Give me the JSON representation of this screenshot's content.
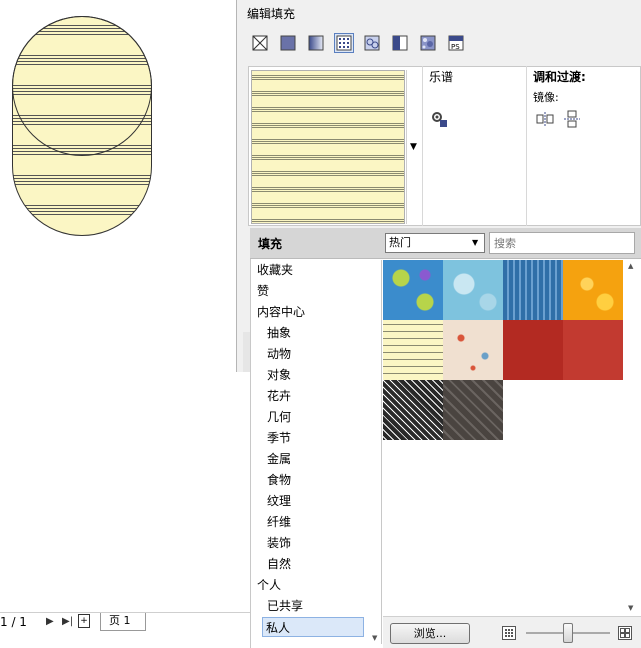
{
  "dialog": {
    "title": "编辑填充"
  },
  "fill_types": [
    {
      "name": "no-fill",
      "selected": false
    },
    {
      "name": "uniform-fill",
      "selected": false
    },
    {
      "name": "fountain-fill",
      "selected": false
    },
    {
      "name": "vector-pattern-fill",
      "selected": true
    },
    {
      "name": "bitmap-pattern-fill",
      "selected": false
    },
    {
      "name": "two-color-pattern-fill",
      "selected": false
    },
    {
      "name": "texture-fill",
      "selected": false
    },
    {
      "name": "postscript-fill",
      "selected": false
    }
  ],
  "preview": {
    "fill_name": "乐谱",
    "blend_title": "调和过渡:",
    "mirror_label": "镜像:"
  },
  "picker": {
    "label": "填充",
    "filter_value": "热门",
    "search_placeholder": "搜索",
    "browse_label": "浏览...",
    "categories": [
      {
        "label": "收藏夹",
        "level": 0
      },
      {
        "label": "赞",
        "level": 0
      },
      {
        "label": "内容中心",
        "level": 0
      },
      {
        "label": "抽象",
        "level": 1
      },
      {
        "label": "动物",
        "level": 1
      },
      {
        "label": "对象",
        "level": 1
      },
      {
        "label": "花卉",
        "level": 1
      },
      {
        "label": "几何",
        "level": 1
      },
      {
        "label": "季节",
        "level": 1
      },
      {
        "label": "金属",
        "level": 1
      },
      {
        "label": "食物",
        "level": 1
      },
      {
        "label": "纹理",
        "level": 1
      },
      {
        "label": "纤维",
        "level": 1
      },
      {
        "label": "装饰",
        "level": 1
      },
      {
        "label": "自然",
        "level": 1
      },
      {
        "label": "个人",
        "level": 0
      },
      {
        "label": "已共享",
        "level": 1
      },
      {
        "label": "私人",
        "level": 1,
        "selected": true
      }
    ],
    "thumbnail_colors": [
      "#3b8ccc",
      "#7ec3de",
      "#2f6fa8",
      "#f5a20f",
      "#fbf6c4",
      "#f0e0d0",
      "#b32a22",
      "#c23a30",
      "#2a2a2a",
      "#4a4440"
    ]
  },
  "status": {
    "page_counter": "1 / 1",
    "page_tab": "页 1"
  }
}
